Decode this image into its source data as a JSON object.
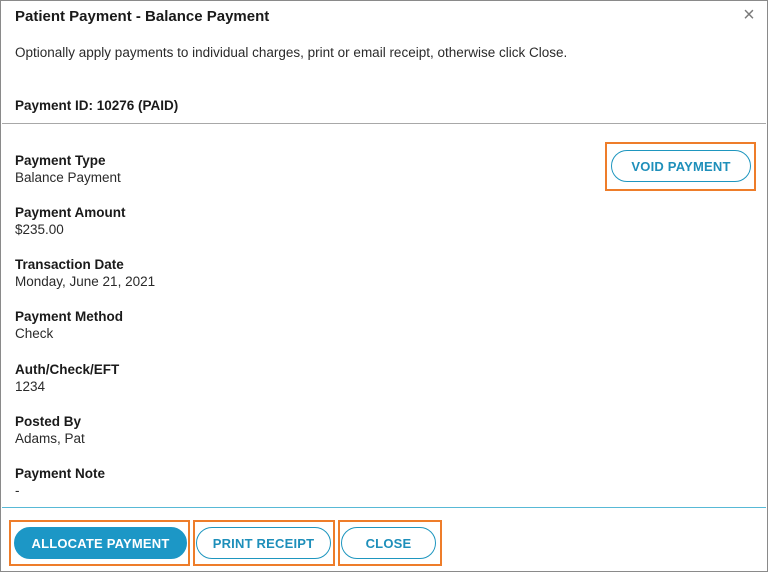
{
  "dialog": {
    "title": "Patient Payment - Balance Payment",
    "close_icon": "×",
    "subtitle": "Optionally apply payments to individual charges, print or email receipt, otherwise click Close.",
    "payment_id": "Payment ID: 10276 (PAID)"
  },
  "fields": [
    {
      "label": "Payment Type",
      "value": "Balance Payment"
    },
    {
      "label": "Payment Amount",
      "value": "$235.00"
    },
    {
      "label": "Transaction Date",
      "value": "Monday, June 21, 2021"
    },
    {
      "label": "Payment Method",
      "value": "Check"
    },
    {
      "label": "Auth/Check/EFT",
      "value": "1234"
    },
    {
      "label": "Posted By",
      "value": "Adams, Pat"
    },
    {
      "label": "Payment Note",
      "value": "-"
    }
  ],
  "buttons": {
    "void_payment": "VOID PAYMENT",
    "allocate_payment": "ALLOCATE PAYMENT",
    "print_receipt": "PRINT RECEIPT",
    "close": "CLOSE"
  },
  "colors": {
    "accent": "#1c97c6",
    "highlight": "#ee7d2a"
  }
}
